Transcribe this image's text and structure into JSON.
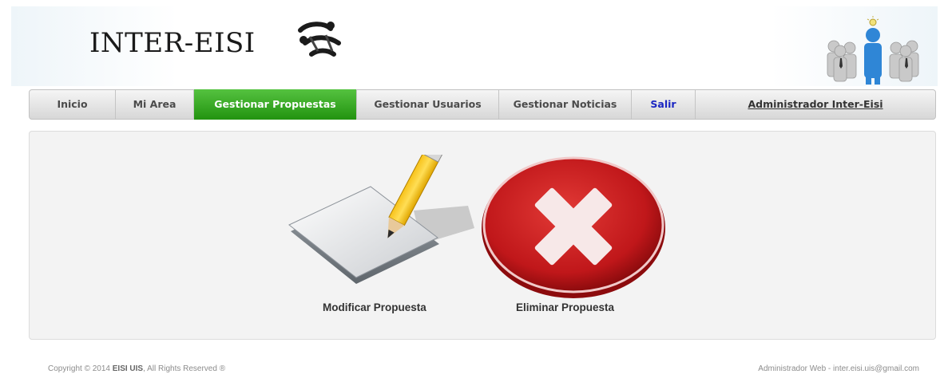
{
  "header": {
    "logo_text": "INTER-EISI",
    "logo_icon": "interlinked-figures-logo",
    "team_icon": "business-team-leader-icon"
  },
  "nav": {
    "items": [
      {
        "label": "Inicio"
      },
      {
        "label": "Mi Area"
      },
      {
        "label": "Gestionar Propuestas",
        "active": true
      },
      {
        "label": "Gestionar Usuarios"
      },
      {
        "label": "Gestionar Noticias"
      },
      {
        "label": "Salir"
      },
      {
        "label": "Administrador Inter-Eisi"
      }
    ],
    "active_color": "#2fa31b",
    "salir_color": "#1a26c2"
  },
  "actions": {
    "modify_label": "Modificar Propuesta",
    "modify_icon": "pencil-paper-icon",
    "delete_label": "Eliminar Propuesta",
    "delete_icon": "red-x-circle-icon",
    "delete_color": "#c0171a"
  },
  "footer": {
    "copyright_prefix": "Copyright © 2014 ",
    "copyright_brand": "EISI UIS",
    "copyright_suffix": ", All Rights Reserved ®",
    "contact": "Administrador Web - inter.eisi.uis@gmail.com"
  }
}
